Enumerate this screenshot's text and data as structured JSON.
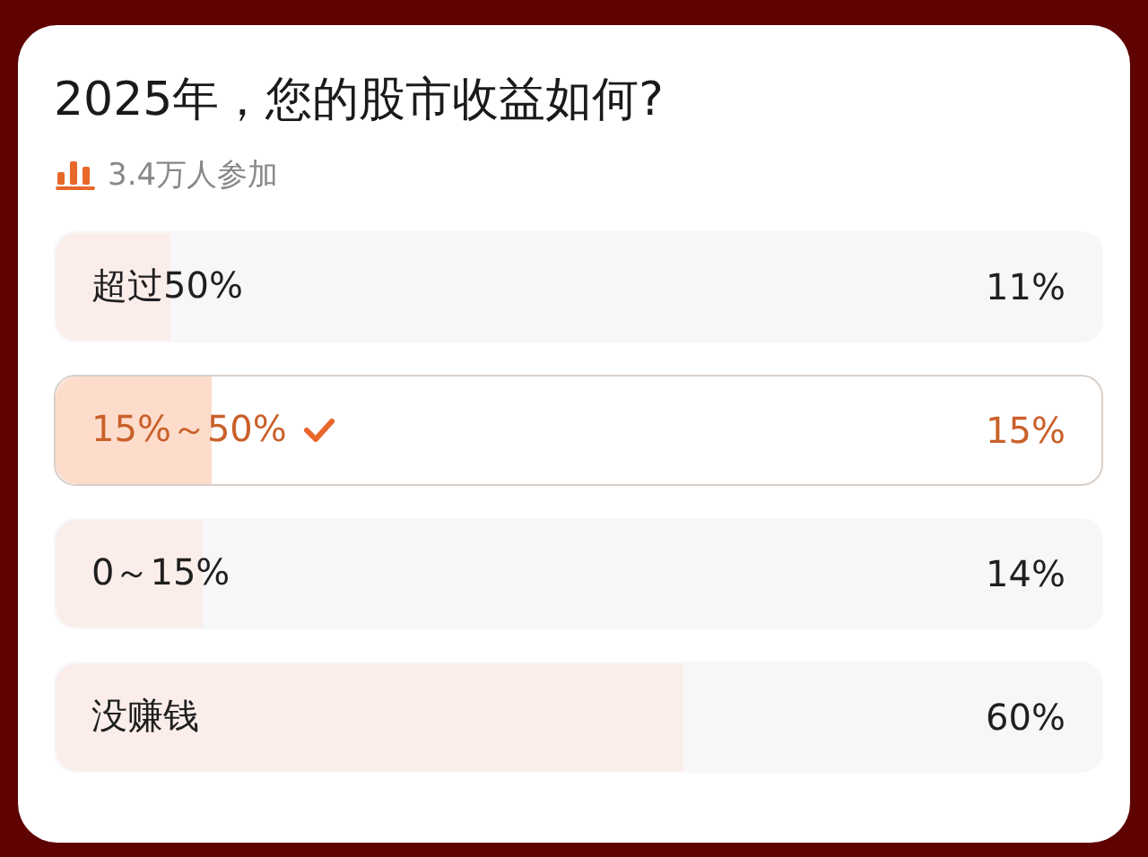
{
  "poll": {
    "question": "2025年，您的股市收益如何?",
    "participants": "3.4万人参加",
    "options": [
      {
        "label": "超过50%",
        "percent": "11%",
        "level": 0.11,
        "selected": false
      },
      {
        "label": "15%～50%",
        "percent": "15%",
        "level": 0.15,
        "selected": true
      },
      {
        "label": "0～15%",
        "percent": "14%",
        "level": 0.14,
        "selected": false
      },
      {
        "label": "没赚钱",
        "percent": "60%",
        "level": 0.6,
        "selected": false
      }
    ]
  }
}
